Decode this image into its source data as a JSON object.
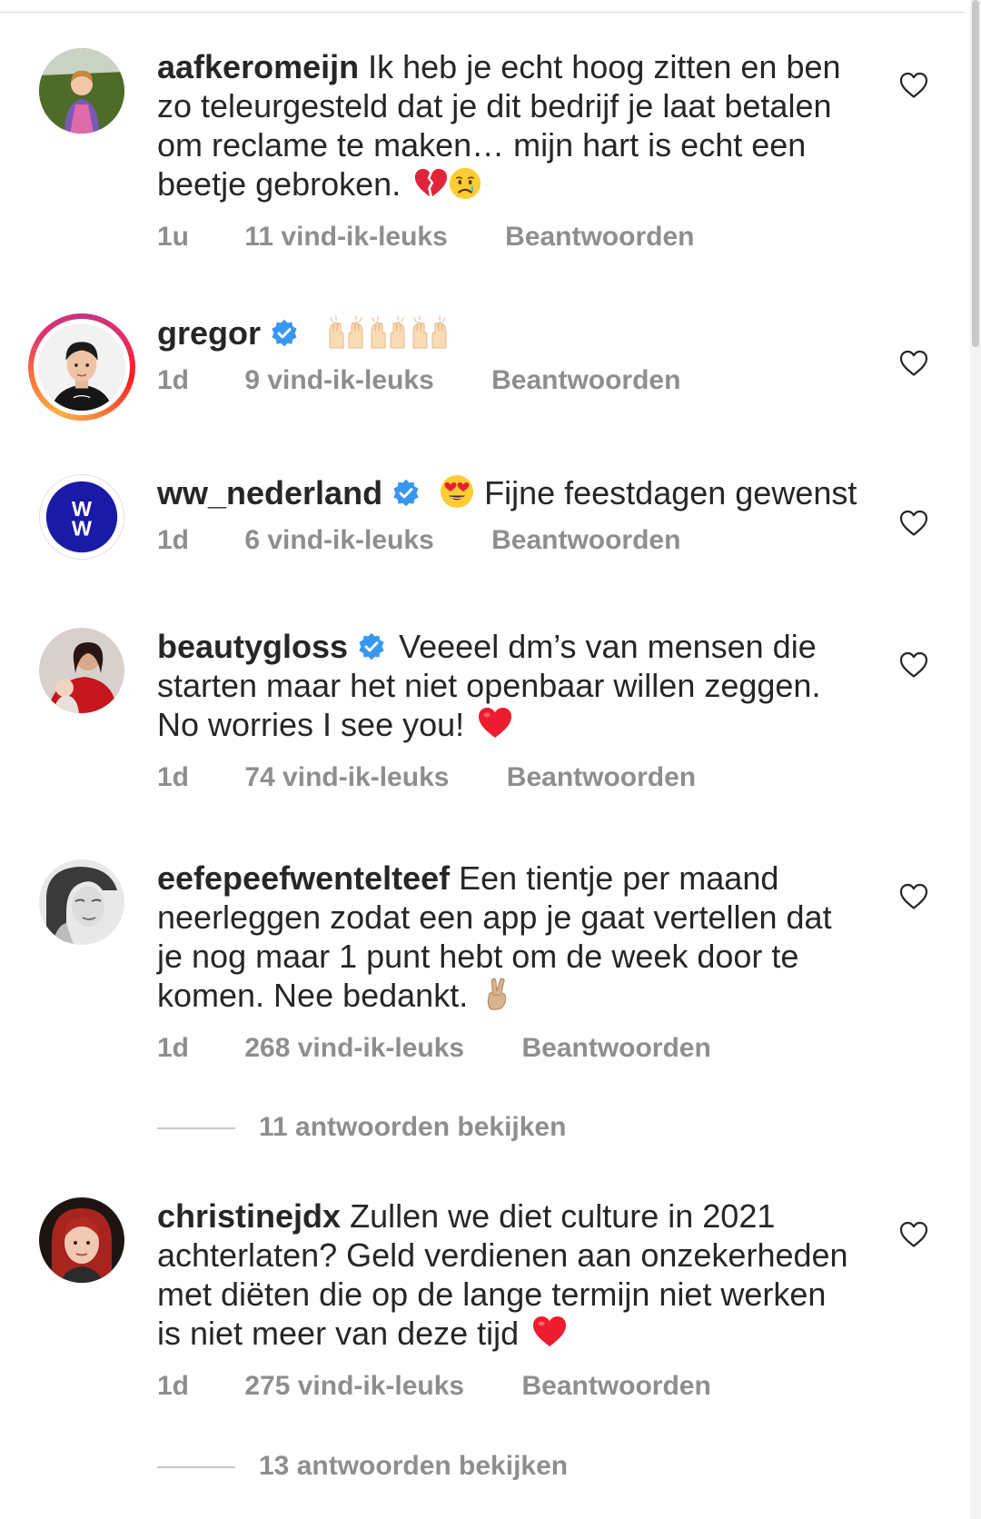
{
  "comments": [
    {
      "username": "aafkeromeijn",
      "verified": false,
      "text_lines": [
        "Ik heb je echt hoog zitten en ben",
        "zo teleurgesteld dat je dit bedrijf je laat betalen",
        "om reclame te maken… mijn hart is echt een",
        "beetje gebroken."
      ],
      "emoji": [
        "broken-heart-emoji",
        "crying-face-emoji"
      ],
      "time": "1u",
      "likes": "11 vind-ik-leuks",
      "reply_label": "Beantwoorden"
    },
    {
      "username": "gregor",
      "verified": true,
      "text_lines": [
        ""
      ],
      "emoji": [
        "raising-hands-emoji",
        "raising-hands-emoji",
        "raising-hands-emoji"
      ],
      "time": "1d",
      "likes": "9 vind-ik-leuks",
      "reply_label": "Beantwoorden"
    },
    {
      "username": "ww_nederland",
      "verified": true,
      "text_lines": [
        "Fijne feestdagen gewenst"
      ],
      "emoji": [
        "heart-eyes-emoji"
      ],
      "time": "1d",
      "likes": "6 vind-ik-leuks",
      "reply_label": "Beantwoorden"
    },
    {
      "username": "beautygloss",
      "verified": true,
      "text_lines": [
        "Veeeel dm’s van mensen die",
        "starten maar het niet openbaar willen zeggen.",
        "No worries I see you!"
      ],
      "emoji": [
        "red-heart-emoji"
      ],
      "time": "1d",
      "likes": "74 vind-ik-leuks",
      "reply_label": "Beantwoorden"
    },
    {
      "username": "eefepeefwentelteef",
      "verified": false,
      "text_lines": [
        "Een tientje per maand",
        "neerleggen zodat een app je gaat vertellen dat",
        "je nog maar 1 punt hebt om de week door te",
        "komen. Nee bedankt."
      ],
      "emoji": [
        "victory-hand-emoji"
      ],
      "time": "1d",
      "likes": "268 vind-ik-leuks",
      "reply_label": "Beantwoorden",
      "view_replies": "11 antwoorden bekijken"
    },
    {
      "username": "christinejdx",
      "verified": false,
      "text_lines": [
        "Zullen we diet culture in 2021",
        "achterlaten? Geld verdienen aan onzekerheden",
        "met diëten die op de lange termijn niet werken",
        "is niet meer van deze tijd"
      ],
      "emoji": [
        "red-heart-emoji"
      ],
      "time": "1d",
      "likes": "275 vind-ik-leuks",
      "reply_label": "Beantwoorden",
      "view_replies": "13 antwoorden bekijken"
    }
  ],
  "colors": {
    "text": "#262626",
    "secondary": "#8e8e8e",
    "verified_blue": "#3897f0",
    "heart_red": "#ed1c2e"
  }
}
